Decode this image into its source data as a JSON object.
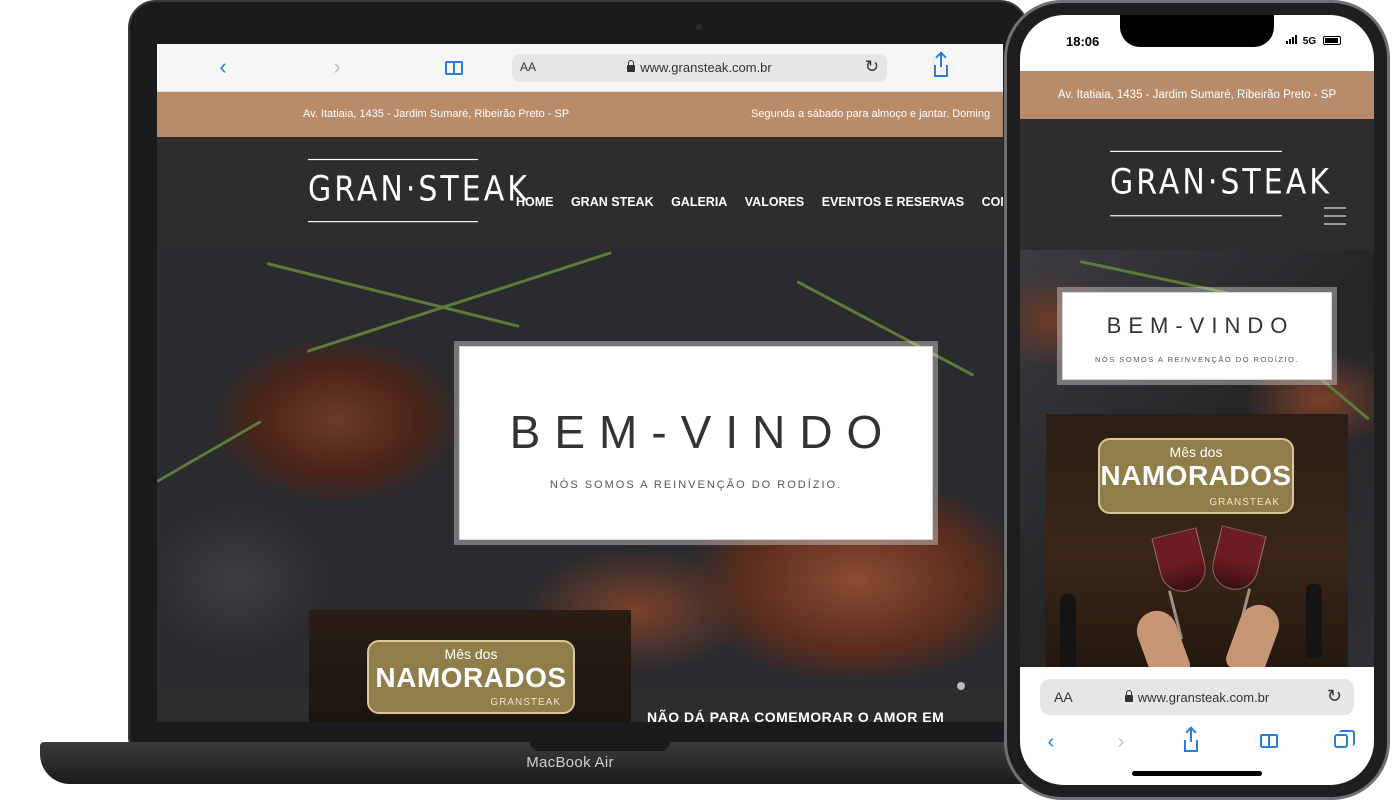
{
  "laptop": {
    "model_label": "MacBook Air",
    "browser": {
      "text_size_label": "AA",
      "url": "www.gransteak.com.br",
      "back_icon": "chevron-left-icon",
      "forward_icon": "chevron-right-icon",
      "bookmarks_icon": "book-icon",
      "share_icon": "share-icon",
      "reload_icon": "reload-icon"
    },
    "site": {
      "address": "Av. Itatiaia, 1435 - Jardim Sumaré, Ribeirão Preto - SP",
      "hours": "Segunda a sábado para almoço e jantar. Doming",
      "logo": "GRAN·STEAK",
      "nav": [
        "HOME",
        "GRAN STEAK",
        "GALERIA",
        "VALORES",
        "EVENTOS E RESERVAS",
        "CONTATO"
      ],
      "welcome_title": "BEM-VINDO",
      "welcome_subtitle": "NÓS SOMOS A REINVENÇÃO DO RODÍZIO.",
      "promo_small": "Mês dos",
      "promo_big": "NAMORADOS",
      "promo_logo": "GRANSTEAK",
      "bottom_text": "NÃO DÁ PARA COMEMORAR O AMOR EM"
    }
  },
  "phone": {
    "status": {
      "time": "18:06",
      "network": "5G"
    },
    "site": {
      "address": "Av. Itatiaia, 1435 - Jardim Sumaré, Ribeirão Preto - SP",
      "logo": "GRAN·STEAK",
      "welcome_title": "BEM-VINDO",
      "welcome_subtitle": "NÓS SOMOS A REINVENÇÃO DO RODÍZIO.",
      "promo_small": "Mês dos",
      "promo_big": "NAMORADOS",
      "promo_logo": "GRANSTEAK"
    },
    "browser": {
      "text_size_label": "AA",
      "url": "www.gransteak.com.br"
    }
  },
  "colors": {
    "accent_bar": "#b88b6a",
    "header_bg": "#2d2d2d",
    "ios_blue": "#2a7de1",
    "promo_gold": "#8f7d4a"
  }
}
